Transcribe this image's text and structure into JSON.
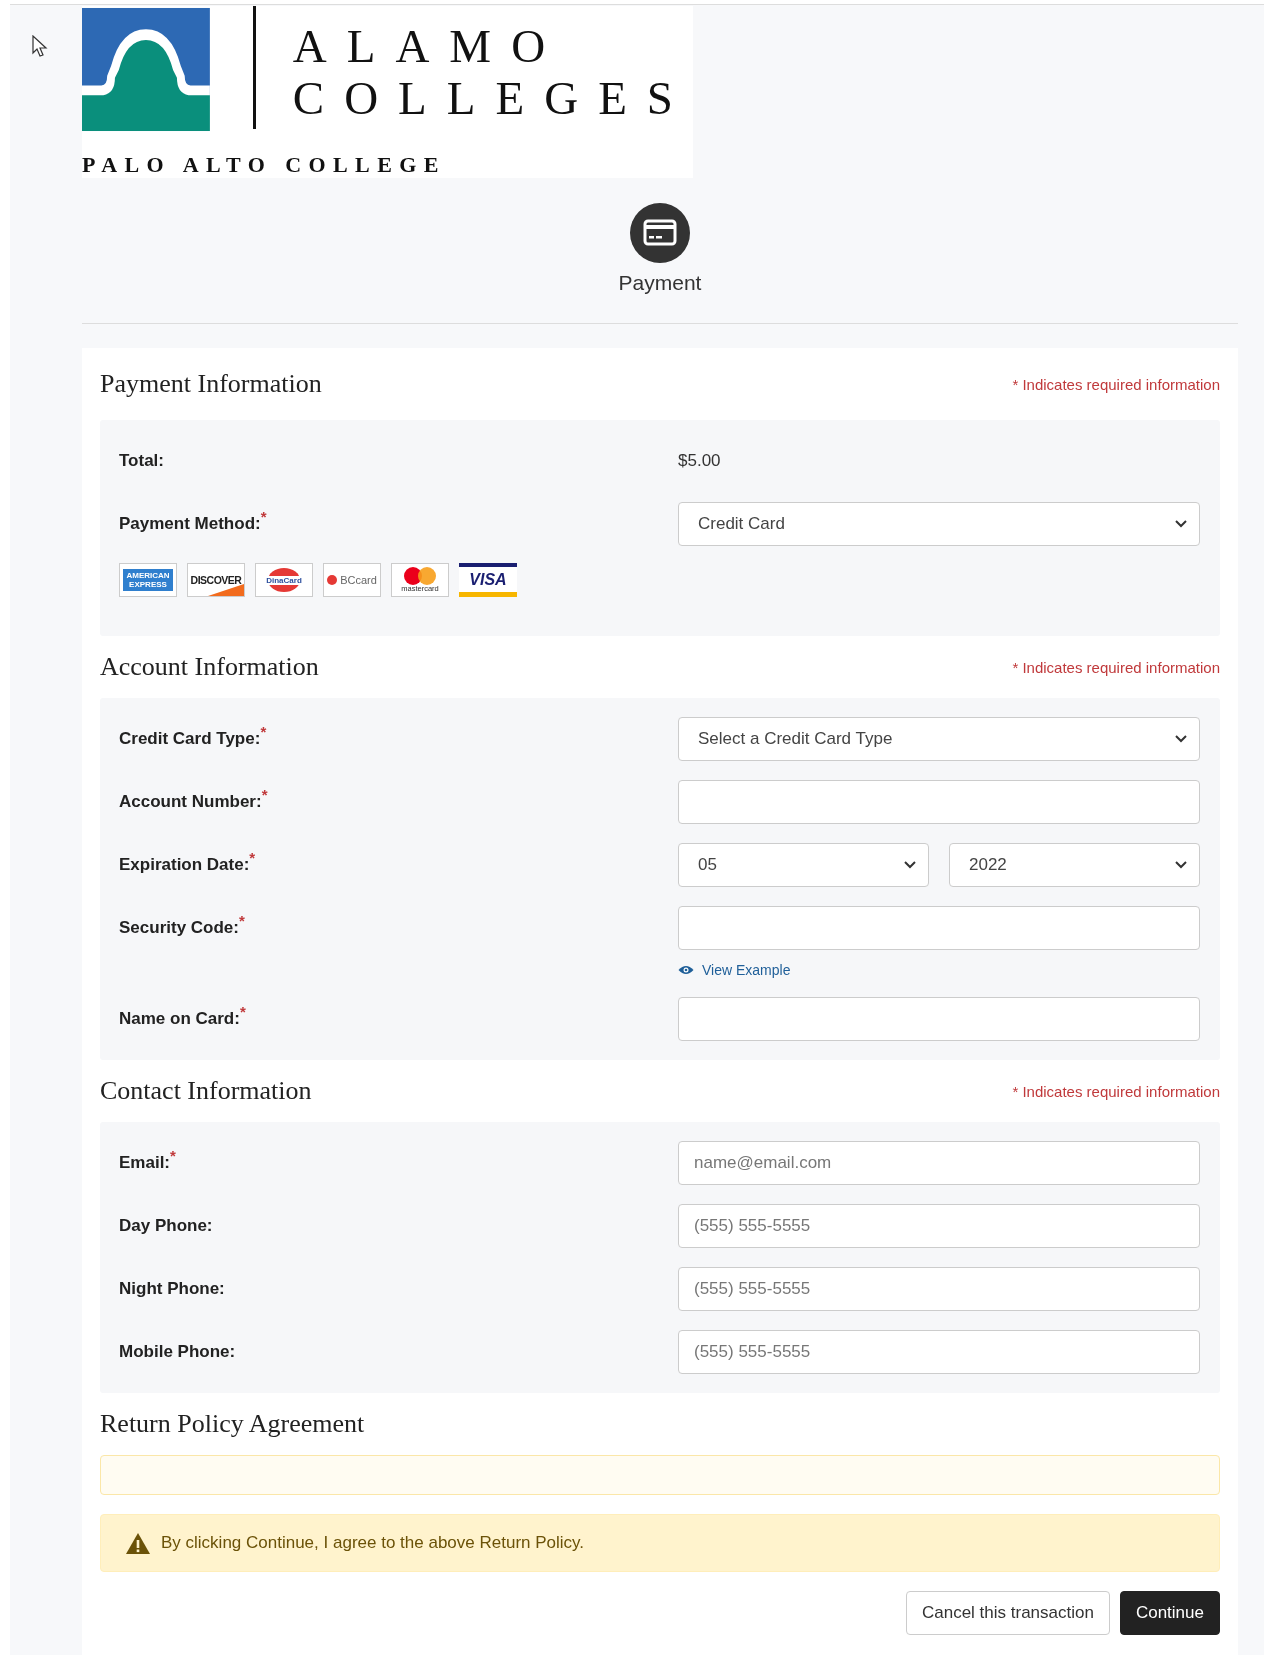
{
  "logo": {
    "line1": "ALAMO",
    "line2": "COLLEGES",
    "subtitle": "PALO ALTO COLLEGE"
  },
  "step": {
    "label": "Payment"
  },
  "sections": [
    {
      "title": "Payment Information",
      "note": "* Indicates required information",
      "rows": [
        {
          "kind": "text",
          "label": "Total:",
          "value": "$5.00"
        },
        {
          "kind": "select",
          "label": "Payment Method:",
          "mark": "*",
          "value": "Credit Card"
        }
      ],
      "cards": [
        {
          "kind": "amex",
          "label": "AMERICAN EXPRESS"
        },
        {
          "kind": "discover",
          "label": "DISCOVER"
        },
        {
          "kind": "dinacard",
          "label": "DinaCard"
        },
        {
          "kind": "bccard",
          "label": "BCcard"
        },
        {
          "kind": "mastercard",
          "label": "mastercard"
        },
        {
          "kind": "visa",
          "label": "VISA"
        }
      ]
    },
    {
      "title": "Account Information",
      "note": "* Indicates required information",
      "rows": [
        {
          "kind": "select",
          "label": "Credit Card Type:",
          "mark": "*",
          "value": "Select a Credit Card Type"
        },
        {
          "kind": "input",
          "label": "Account Number:",
          "mark": "*"
        },
        {
          "kind": "date",
          "label": "Expiration Date:",
          "mark": "*",
          "values": [
            "05",
            "2022"
          ]
        },
        {
          "kind": "input",
          "label": "Security Code:",
          "mark": "*",
          "link": "View Example"
        },
        {
          "kind": "input",
          "label": "Name on Card:",
          "mark": "*"
        }
      ]
    },
    {
      "title": "Contact Information",
      "note": "* Indicates required information",
      "rows": [
        {
          "kind": "input",
          "label": "Email:",
          "mark": "*",
          "placeholder": "name@email.com"
        },
        {
          "kind": "input",
          "label": "Day Phone:",
          "placeholder": "(555) 555-5555"
        },
        {
          "kind": "input",
          "label": "Night Phone:",
          "placeholder": "(555) 555-5555"
        },
        {
          "kind": "input",
          "label": "Mobile Phone:",
          "placeholder": "(555) 555-5555"
        }
      ]
    }
  ],
  "return_policy": {
    "title": "Return Policy Agreement",
    "alert": "By clicking Continue, I agree to the above Return Policy."
  },
  "buttons": [
    {
      "kind": "secondary",
      "label": "Cancel this transaction"
    },
    {
      "kind": "primary",
      "label": "Continue"
    }
  ]
}
